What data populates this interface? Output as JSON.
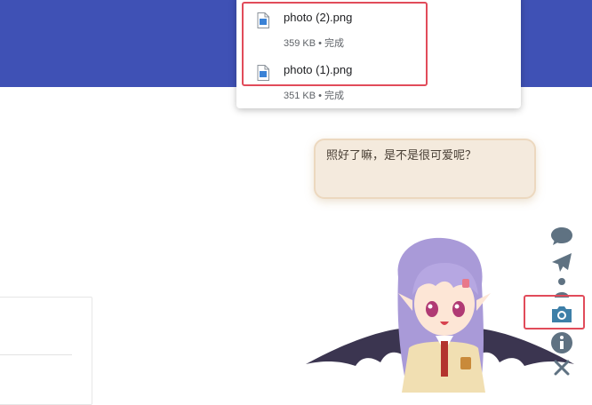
{
  "downloads": {
    "items": [
      {
        "filename": "photo (2).png",
        "size": "359 KB",
        "separator": "•",
        "status": "完成"
      },
      {
        "filename": "photo (1).png",
        "size": "351 KB",
        "separator": "•",
        "status": "完成"
      }
    ]
  },
  "mascot": {
    "message": "照好了嘛，是不是很可爱呢？"
  },
  "toolbar": {
    "icons": [
      "chat-icon",
      "paper-plane-icon",
      "person-icon",
      "camera-icon",
      "info-icon",
      "close-icon"
    ]
  },
  "colors": {
    "banner": "#3f51b5",
    "highlight": "#e14b5a",
    "toolbar_icon": "#5f7282",
    "camera_active": "#3d7fa8",
    "bubble_bg": "#f4eadd"
  }
}
